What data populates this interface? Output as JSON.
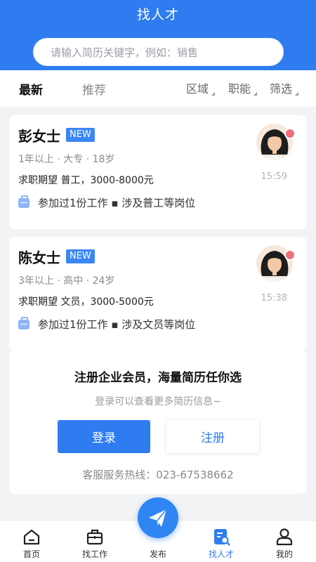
{
  "header": {
    "title": "找人才"
  },
  "search": {
    "placeholder": "请输入简历关键字，例如：销售"
  },
  "tabs": [
    {
      "label": "最新",
      "active": true
    },
    {
      "label": "推荐",
      "active": false
    }
  ],
  "filters": [
    {
      "label": "区域"
    },
    {
      "label": "职能"
    },
    {
      "label": "筛选"
    }
  ],
  "candidates": [
    {
      "name": "彭女士",
      "badge": "NEW",
      "meta": "1年以上 · 大专 · 18岁",
      "expect": "求职期望 普工，3000-8000元",
      "experience": "参加过1份工作 ▪ 涉及普工等岗位",
      "time": "15:59"
    },
    {
      "name": "陈女士",
      "badge": "NEW",
      "meta": "3年以上 · 高中 · 24岁",
      "expect": "求职期望 文员，3000-5000元",
      "experience": "参加过1份工作 ▪ 涉及文员等岗位",
      "time": "15:38"
    }
  ],
  "promo": {
    "title": "注册企业会员，海量简历任你选",
    "subtitle": "登录可以查看更多简历信息~",
    "login_label": "登录",
    "register_label": "注册",
    "hotline": "客服服务热线：023-67538662"
  },
  "nav": [
    {
      "label": "首页",
      "icon": "home-icon"
    },
    {
      "label": "找工作",
      "icon": "briefcase-icon"
    },
    {
      "label": "发布",
      "icon": "paper-plane-icon"
    },
    {
      "label": "找人才",
      "icon": "resume-search-icon",
      "active": true
    },
    {
      "label": "我的",
      "icon": "user-icon"
    }
  ],
  "colors": {
    "primary": "#2f7cf0",
    "badge": "#3b86f5",
    "background": "#f2f3f5"
  }
}
